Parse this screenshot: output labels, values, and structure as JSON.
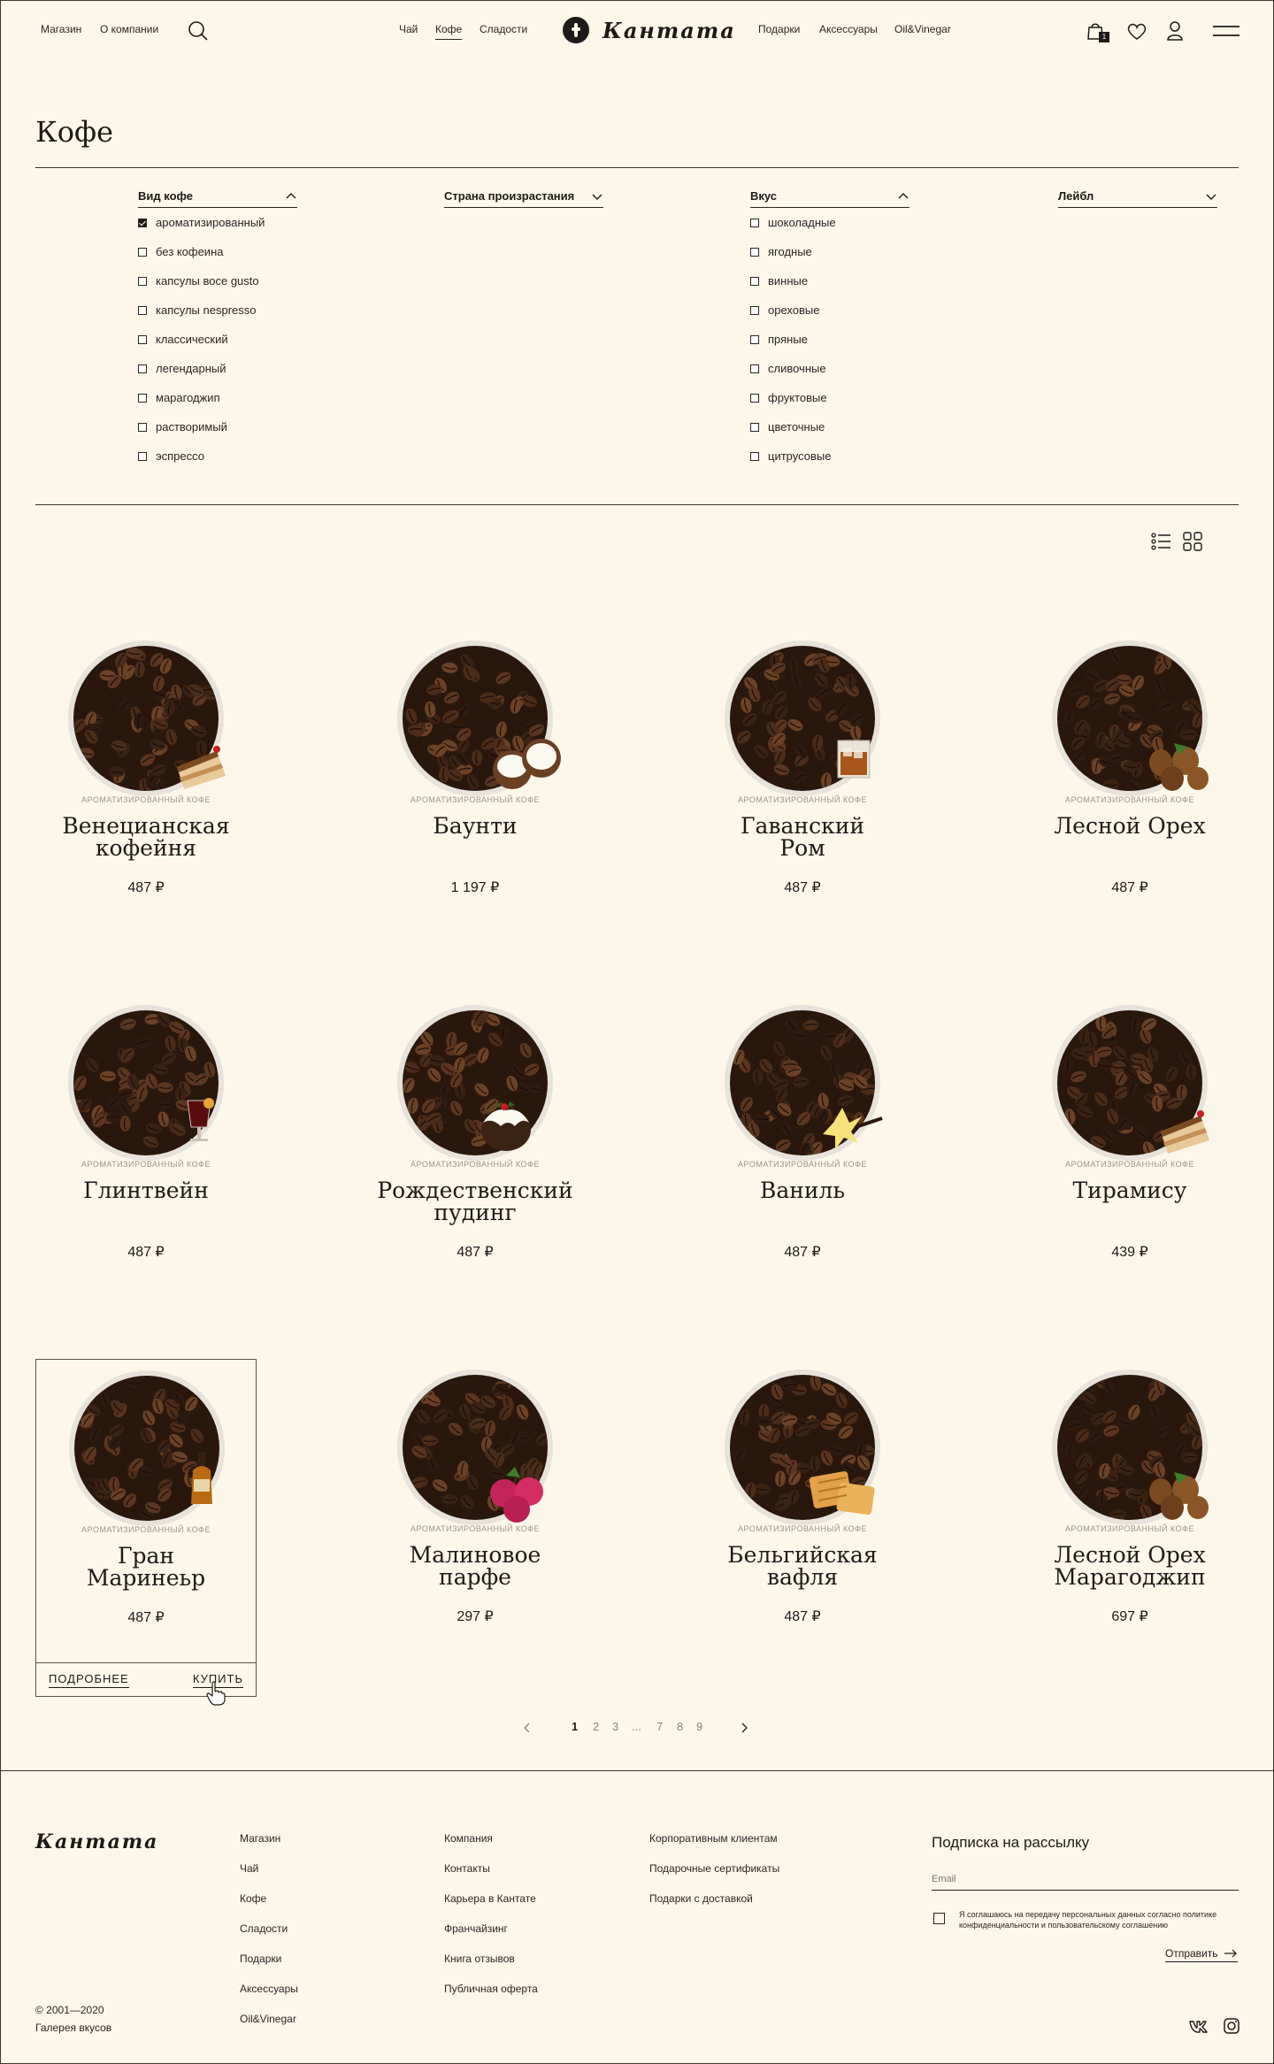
{
  "header": {
    "nav_left": [
      "Магазин",
      "О компании"
    ],
    "nav_center_left": [
      "Чай",
      "Кофе",
      "Сладости"
    ],
    "nav_center_right": [
      "Подарки",
      "Аксессуары",
      "Oil&Vinegar"
    ],
    "logo": "Кантата",
    "cart_count": "1"
  },
  "page": {
    "title": "Кофе"
  },
  "filters": [
    {
      "label": "Вид кофе",
      "expanded": true,
      "options": [
        {
          "label": "ароматизированный",
          "checked": true
        },
        {
          "label": "без кофеина",
          "checked": false
        },
        {
          "label": "капсулы восе gusto",
          "checked": false
        },
        {
          "label": "капсулы nespresso",
          "checked": false
        },
        {
          "label": "классический",
          "checked": false
        },
        {
          "label": "легендарный",
          "checked": false
        },
        {
          "label": "марагоджип",
          "checked": false
        },
        {
          "label": "растворимый",
          "checked": false
        },
        {
          "label": "эспрессо",
          "checked": false
        }
      ]
    },
    {
      "label": "Страна произрастания",
      "expanded": false,
      "options": []
    },
    {
      "label": "Вкус",
      "expanded": true,
      "options": [
        {
          "label": "шоколадные",
          "checked": false
        },
        {
          "label": "ягодные",
          "checked": false
        },
        {
          "label": "винные",
          "checked": false
        },
        {
          "label": "ореховые",
          "checked": false
        },
        {
          "label": "пряные",
          "checked": false
        },
        {
          "label": "сливочные",
          "checked": false
        },
        {
          "label": "фруктовые",
          "checked": false
        },
        {
          "label": "цветочные",
          "checked": false
        },
        {
          "label": "цитрусовые",
          "checked": false
        }
      ]
    },
    {
      "label": "Лейбл",
      "expanded": false,
      "options": []
    }
  ],
  "products": [
    {
      "category": "Ароматизированный кофе",
      "name": [
        "Венецианская",
        "кофейня"
      ],
      "price": "487 ₽",
      "topping": "tiramisu"
    },
    {
      "category": "Ароматизированный кофе",
      "name": [
        "Баунти"
      ],
      "price": "1 197 ₽",
      "topping": "coconut"
    },
    {
      "category": "Ароматизированный кофе",
      "name": [
        "Гаванский",
        "Ром"
      ],
      "price": "487 ₽",
      "topping": "rum-glass"
    },
    {
      "category": "Ароматизированный кофе",
      "name": [
        "Лесной Орех"
      ],
      "price": "487 ₽",
      "topping": "hazelnut"
    },
    {
      "category": "Ароматизированный кофе",
      "name": [
        "Глинтвейн"
      ],
      "price": "487 ₽",
      "topping": "mulled-wine"
    },
    {
      "category": "Ароматизированный кофе",
      "name": [
        "Рождественский",
        "пудинг"
      ],
      "price": "487 ₽",
      "topping": "pudding"
    },
    {
      "category": "Ароматизированный кофе",
      "name": [
        "Ваниль"
      ],
      "price": "487 ₽",
      "topping": "vanilla"
    },
    {
      "category": "Ароматизированный кофе",
      "name": [
        "Тирамису"
      ],
      "price": "439 ₽",
      "topping": "tiramisu"
    },
    {
      "category": "Ароматизированный кофе",
      "name": [
        "Гран",
        "Маринеьр"
      ],
      "price": "487 ₽",
      "topping": "liqueur"
    },
    {
      "category": "Ароматизированный кофе",
      "name": [
        "Малиновое",
        "парфе"
      ],
      "price": "297 ₽",
      "topping": "raspberry"
    },
    {
      "category": "Ароматизированный кофе",
      "name": [
        "Бельгийская",
        "вафля"
      ],
      "price": "487 ₽",
      "topping": "waffle"
    },
    {
      "category": "Ароматизированный кофе",
      "name": [
        "Лесной Орех",
        "Марагоджип"
      ],
      "price": "697 ₽",
      "topping": "hazelnut"
    }
  ],
  "card_actions": {
    "details": "ПОДРОБНЕЕ",
    "buy": "КУПИТЬ"
  },
  "pagination": {
    "pages": [
      "1",
      "2",
      "3",
      "...",
      "7",
      "8",
      "9"
    ],
    "current": "1"
  },
  "footer": {
    "logo": "Кантата",
    "col1": [
      "Магазин",
      "Чай",
      "Кофе",
      "Сладости",
      "Подарки",
      "Аксессуары",
      "Oil&Vinegar"
    ],
    "col2": [
      "Компания",
      "Контакты",
      "Карьера в Кантате",
      "Франчайзинг",
      "Книга отзывов",
      "Публичная оферта"
    ],
    "col3": [
      "Корпоративным клиентам",
      "Подарочные сертификаты",
      "Подарки с доставкой"
    ],
    "copyright": "© 2001—2020",
    "copyright2": "Галерея вкусов",
    "subscribe_title": "Подписка на рассылку",
    "email_placeholder": "Email",
    "consent": "Я соглашаюсь на передачу персональных данных согласно политике конфиденциальности и пользовательскому соглашению",
    "send": "Отправить"
  }
}
